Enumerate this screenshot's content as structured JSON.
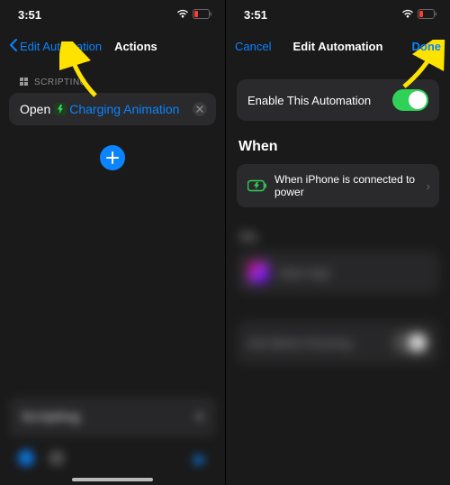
{
  "status": {
    "time": "3:51"
  },
  "left": {
    "back_label": "Edit Automation",
    "title": "Actions",
    "section_label": "SCRIPTING",
    "open_label": "Open",
    "app_name": "Charging Animation",
    "bottom_blur": "Scripting"
  },
  "right": {
    "cancel": "Cancel",
    "title": "Edit Automation",
    "done": "Done",
    "enable_label": "Enable This Automation",
    "when_heading": "When",
    "when_text": "When iPhone is connected to power",
    "do_heading": "Do",
    "open_app": "Open App",
    "ask_row": "Ask Before Running"
  }
}
